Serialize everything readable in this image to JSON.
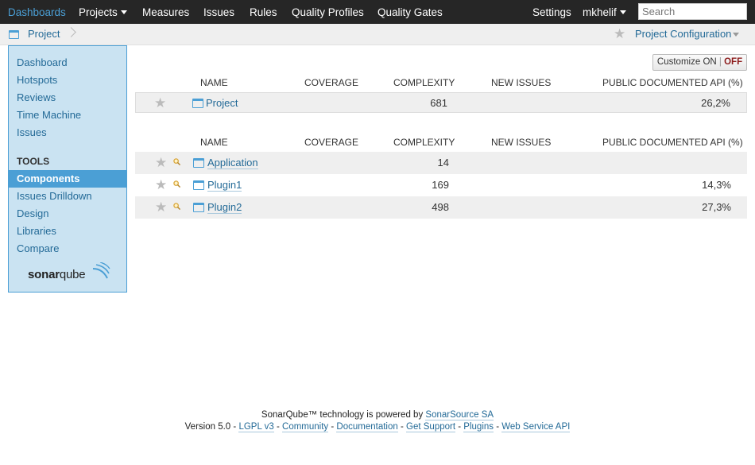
{
  "nav": {
    "dashboards": "Dashboards",
    "projects": "Projects",
    "measures": "Measures",
    "issues": "Issues",
    "rules": "Rules",
    "quality_profiles": "Quality Profiles",
    "quality_gates": "Quality Gates",
    "settings": "Settings",
    "user": "mkhelif",
    "search_placeholder": "Search"
  },
  "breadcrumb": {
    "project": "Project",
    "config": "Project Configuration"
  },
  "sidebar": {
    "items": [
      "Dashboard",
      "Hotspots",
      "Reviews",
      "Time Machine",
      "Issues"
    ],
    "tools_heading": "TOOLS",
    "tools": [
      "Components",
      "Issues Drilldown",
      "Design",
      "Libraries",
      "Compare"
    ],
    "logo_bold": "sonar",
    "logo_light": "qube"
  },
  "customize": {
    "label": "Customize",
    "on": "ON",
    "sep": "|",
    "off": "OFF"
  },
  "columns": {
    "name": "NAME",
    "coverage": "COVERAGE",
    "complexity": "COMPLEXITY",
    "new_issues": "NEW ISSUES",
    "api": "PUBLIC DOCUMENTED API (%)"
  },
  "project_row": {
    "name": "Project",
    "complexity": "681",
    "api": "26,2%"
  },
  "components": [
    {
      "name": "Application",
      "complexity": "14",
      "api": ""
    },
    {
      "name": "Plugin1",
      "complexity": "169",
      "api": "14,3%"
    },
    {
      "name": "Plugin2",
      "complexity": "498",
      "api": "27,3%"
    }
  ],
  "footer": {
    "line1_prefix": "SonarQube™ technology is powered by",
    "line1_link": "SonarSource SA",
    "version": "Version 5.0",
    "links": [
      "LGPL v3",
      "Community",
      "Documentation",
      "Get Support",
      "Plugins",
      "Web Service API"
    ],
    "separator": "-"
  },
  "colors": {
    "nav_bg": "#262626",
    "accent": "#4b9fd5",
    "link": "#236a97",
    "sidebar_bg": "#cae3f2",
    "off": "#8b1a1a"
  }
}
